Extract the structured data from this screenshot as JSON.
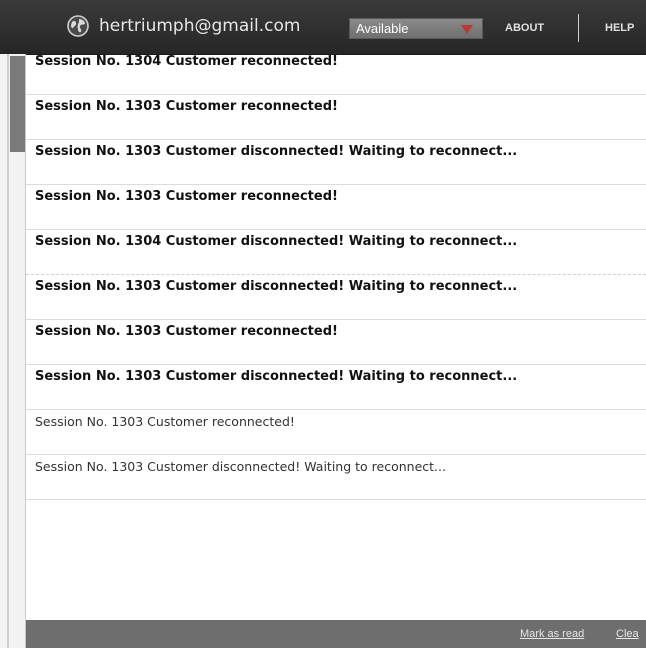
{
  "header": {
    "account_email": "hertriumph@gmail.com",
    "status": {
      "selected": "Available"
    },
    "nav": {
      "about": "ABOUT",
      "help": "HELP"
    }
  },
  "notifications": [
    {
      "text": "Session No. 1304 Customer reconnected!",
      "read": false
    },
    {
      "text": "Session No. 1303 Customer reconnected!",
      "read": false
    },
    {
      "text": "Session No. 1303 Customer disconnected! Waiting to reconnect...",
      "read": false
    },
    {
      "text": "Session No. 1303 Customer reconnected!",
      "read": false
    },
    {
      "text": "Session No. 1304 Customer disconnected! Waiting to reconnect...",
      "read": false
    },
    {
      "text": "Session No. 1303 Customer disconnected! Waiting to reconnect...",
      "read": false
    },
    {
      "text": "Session No. 1303 Customer reconnected!",
      "read": false
    },
    {
      "text": "Session No. 1303 Customer disconnected! Waiting to reconnect...",
      "read": false
    },
    {
      "text": "Session No. 1303 Customer reconnected!",
      "read": true
    },
    {
      "text": "Session No. 1303 Customer disconnected! Waiting to reconnect...",
      "read": true
    }
  ],
  "footer": {
    "mark_as_read": "Mark as read",
    "clear": "Clea"
  },
  "colors": {
    "topbar": "#2e2e2e",
    "status_arrow": "#b83a3a",
    "footer": "#6e6e6e"
  },
  "icons": {
    "globe": "globe-icon",
    "dropdown": "chevron-down-icon"
  }
}
